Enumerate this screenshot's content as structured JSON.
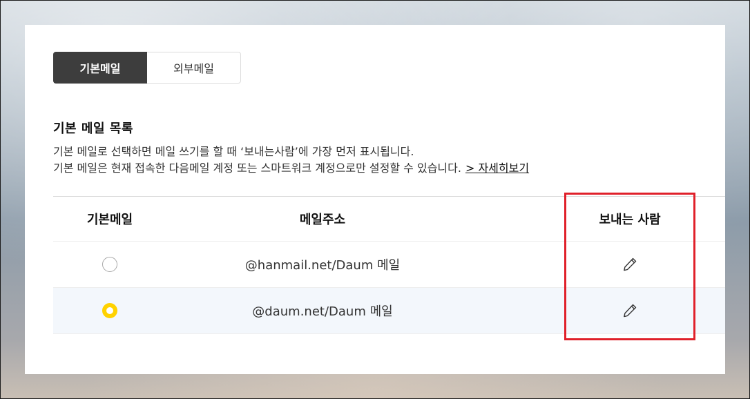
{
  "tabs": [
    {
      "label": "기본메일",
      "active": true
    },
    {
      "label": "외부메일",
      "active": false
    }
  ],
  "section": {
    "title": "기본 메일 목록",
    "desc_line1": "기본 메일로 선택하면 메일 쓰기를 할 때 ‘보내는사람’에 가장 먼저 표시됩니다.",
    "desc_line2": "기본 메일은 현재 접속한 다음메일 계정 또는 스마트워크 계정으로만 설정할 수 있습니다.",
    "more_link": "> 자세히보기"
  },
  "table": {
    "headers": [
      "기본메일",
      "메일주소",
      "보내는 사람"
    ],
    "rows": [
      {
        "address": "@hanmail.net/Daum 메일",
        "selected": false,
        "sender_icon": "pencil-icon"
      },
      {
        "address": "@daum.net/Daum 메일",
        "selected": true,
        "sender_icon": "pencil-icon"
      }
    ]
  },
  "colors": {
    "active_tab_bg": "#3d3d3d",
    "radio_selected": "#ffd200",
    "highlight_border": "#e0202a",
    "selected_row_bg": "#f3f7fc"
  }
}
